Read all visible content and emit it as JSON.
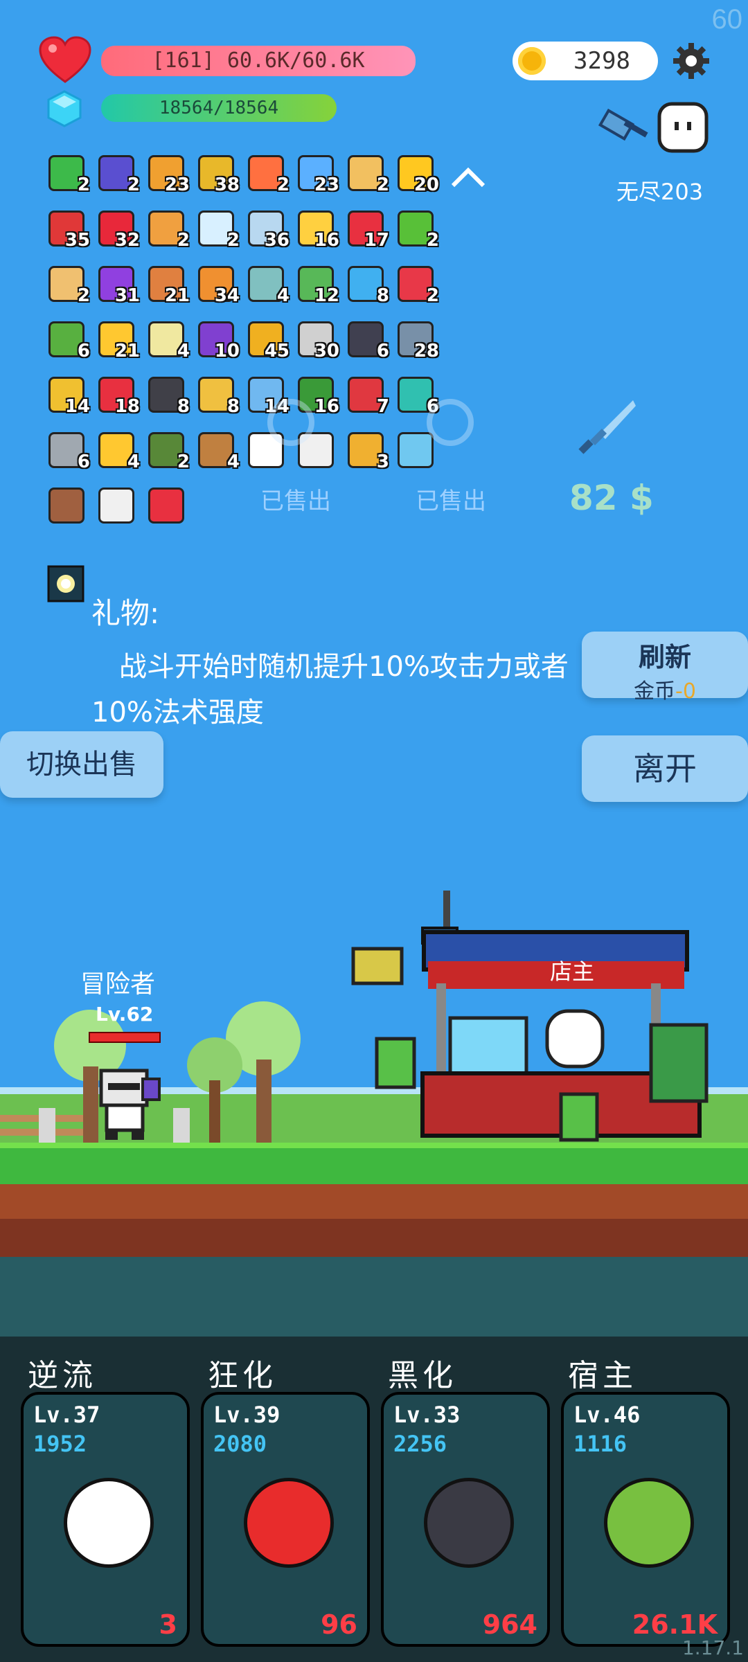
{
  "fps": "60",
  "hp_bar": {
    "text": "[161] 60.6K/60.6K",
    "color_from": "#ff6b7a",
    "color_to": "#ff8fb2"
  },
  "mana_bar": {
    "text": "18564/18564",
    "color_from": "#26c9a0",
    "color_to": "#7ecf3a"
  },
  "coins": "3298",
  "mode_label": "无尽203",
  "items": [
    {
      "icon": "green-card-icon",
      "count": "2",
      "color": "#3dba4a"
    },
    {
      "icon": "wizard-hat-icon",
      "count": "2",
      "color": "#5a4fd0"
    },
    {
      "icon": "scroll-icon",
      "count": "23",
      "color": "#f0a030"
    },
    {
      "icon": "pineapple-egg-icon",
      "count": "38",
      "color": "#e8b82a"
    },
    {
      "icon": "fire-altar-icon",
      "count": "2",
      "color": "#ff7040"
    },
    {
      "icon": "star-card-icon",
      "count": "23",
      "color": "#5bb0ff"
    },
    {
      "icon": "paper-scroll-icon",
      "count": "2",
      "color": "#f2c060"
    },
    {
      "icon": "sunflower-icon",
      "count": "20",
      "color": "#ffc820"
    },
    {
      "icon": "mushroom-icon",
      "count": "35",
      "color": "#e03838"
    },
    {
      "icon": "strawberry-icon",
      "count": "32",
      "color": "#e8283a"
    },
    {
      "icon": "cutlery-card-icon",
      "count": "2",
      "color": "#f0a040"
    },
    {
      "icon": "speed-lines-icon",
      "count": "2",
      "color": "#d8f0ff"
    },
    {
      "icon": "molecule-icon",
      "count": "36",
      "color": "#b8d8f0"
    },
    {
      "icon": "cheese-icon",
      "count": "16",
      "color": "#ffd040"
    },
    {
      "icon": "gift-box-icon",
      "count": "17",
      "color": "#e83040"
    },
    {
      "icon": "potion-flask-icon",
      "count": "2",
      "color": "#58c038"
    },
    {
      "icon": "treasure-map-icon",
      "count": "2",
      "color": "#f0c070"
    },
    {
      "icon": "crystal-ball-icon",
      "count": "31",
      "color": "#9040e0"
    },
    {
      "icon": "flag-bottle-icon",
      "count": "21",
      "color": "#e08040"
    },
    {
      "icon": "briefcase-icon",
      "count": "34",
      "color": "#f09030"
    },
    {
      "icon": "target-disc-icon",
      "count": "4",
      "color": "#80c0c0"
    },
    {
      "icon": "money-heart-icon",
      "count": "12",
      "color": "#58b858"
    },
    {
      "icon": "speech-bubble-icon",
      "count": "8",
      "color": "#40b0f0"
    },
    {
      "icon": "discount-tag-icon",
      "count": "2",
      "color": "#e83848"
    },
    {
      "icon": "goblin-icon",
      "count": "6",
      "color": "#58b040"
    },
    {
      "icon": "sun-cloud-icon",
      "count": "21",
      "color": "#ffc830"
    },
    {
      "icon": "halo-icon",
      "count": "4",
      "color": "#f0e8a0"
    },
    {
      "icon": "purple-chest-icon",
      "count": "10",
      "color": "#8040d0"
    },
    {
      "icon": "pineapple-icon",
      "count": "45",
      "color": "#f0b020"
    },
    {
      "icon": "hook-icon",
      "count": "30",
      "color": "#d0d0d0"
    },
    {
      "icon": "bat-icon",
      "count": "6",
      "color": "#404050"
    },
    {
      "icon": "shield-icon",
      "count": "28",
      "color": "#7890a8"
    },
    {
      "icon": "notebook-pencil-icon",
      "count": "14",
      "color": "#f0c030"
    },
    {
      "icon": "heart-icon",
      "count": "18",
      "color": "#e83040"
    },
    {
      "icon": "skull-book-icon",
      "count": "8",
      "color": "#404048"
    },
    {
      "icon": "ring-icon",
      "count": "8",
      "color": "#f0c040"
    },
    {
      "icon": "shirt-icon",
      "count": "14",
      "color": "#70b8f0"
    },
    {
      "icon": "turtle-shell-icon",
      "count": "16",
      "color": "#3a9a38"
    },
    {
      "icon": "red-shield-icon",
      "count": "7",
      "color": "#e03840"
    },
    {
      "icon": "spiral-card-icon",
      "count": "6",
      "color": "#30c0b0"
    },
    {
      "icon": "compass-icon",
      "count": "6",
      "color": "#a0a8b0"
    },
    {
      "icon": "magic-wand-icon",
      "count": "4",
      "color": "#ffc830"
    },
    {
      "icon": "grenade-icon",
      "count": "2",
      "color": "#588838"
    },
    {
      "icon": "bow-icon",
      "count": "4",
      "color": "#c08040"
    },
    {
      "icon": "chat-bubble-icon",
      "count": "",
      "color": "#ffffff"
    },
    {
      "icon": "envelope-icon",
      "count": "",
      "color": "#f0f0f0"
    },
    {
      "icon": "golden-book-icon",
      "count": "3",
      "color": "#f0b030"
    },
    {
      "icon": "blue-potion-icon",
      "count": "",
      "color": "#70c8f0"
    },
    {
      "icon": "round-shield-icon",
      "count": "",
      "color": "#a06040"
    },
    {
      "icon": "playing-cards-icon",
      "count": "",
      "color": "#f0f0f0"
    },
    {
      "icon": "map-pin-icon",
      "count": "",
      "color": "#e83040"
    }
  ],
  "sold_labels": [
    "已售出",
    "已售出"
  ],
  "price_label": "82 $",
  "gift_title": "礼物:",
  "gift_desc": "战斗开始时随机提升10%攻击力或者10%法术强度",
  "refresh_button": {
    "title": "刷新",
    "cost_label": "金币",
    "cost_value": "-0"
  },
  "switch_sell_button": "切换出售",
  "leave_button": "离开",
  "adventurer": {
    "name": "冒险者",
    "level": "Lv.62"
  },
  "shopkeeper_label": "店主",
  "skills": [
    {
      "name": "逆流",
      "level": "Lv.37",
      "power": "1952",
      "count": "3",
      "icon": "wing-icon",
      "icon_color": "#ffffff"
    },
    {
      "name": "狂化",
      "level": "Lv.39",
      "power": "2080",
      "count": "96",
      "icon": "red-splash-icon",
      "icon_color": "#e82c2c"
    },
    {
      "name": "黑化",
      "level": "Lv.33",
      "power": "2256",
      "count": "964",
      "icon": "dark-tree-monster-icon",
      "icon_color": "#3a3a44"
    },
    {
      "name": "宿主",
      "level": "Lv.46",
      "power": "1116",
      "count": "26.1K",
      "icon": "green-eye-monster-icon",
      "icon_color": "#78c040"
    }
  ],
  "version": "1.17.1"
}
